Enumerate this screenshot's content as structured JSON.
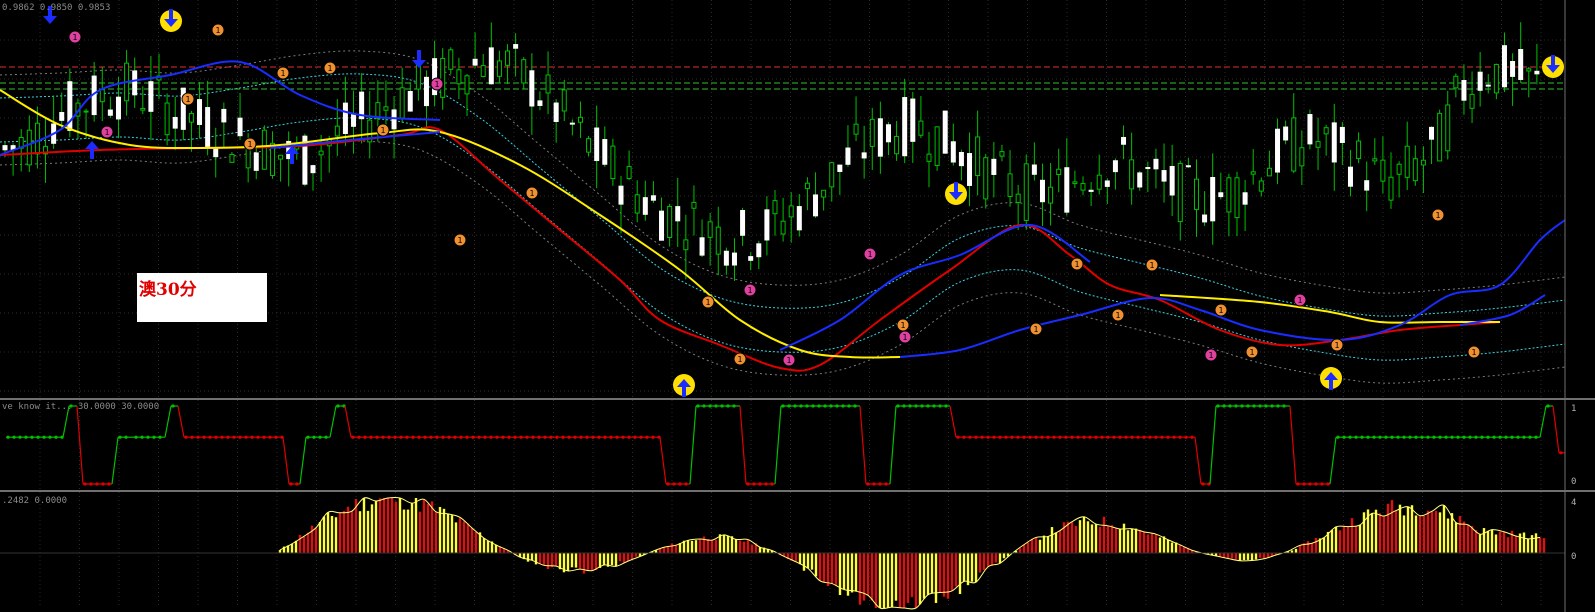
{
  "colors": {
    "background": "#000000",
    "bull": "#ffffff",
    "bear": "#00c000",
    "ema_fast": "#e00000",
    "ema_slow": "#ffee00",
    "ema_mid": "#1a2cff",
    "band": "#3ad1e0",
    "accent_level": "#e03030",
    "level_green": "#30c030",
    "osc_up": "#00c000",
    "osc_down": "#e00000",
    "hist_pos": "#ffff30",
    "hist_neg": "#e01010"
  },
  "main": {
    "header": "0.9862 0.9850 0.9853",
    "symbol_label": "澳30分",
    "arrow_icons": {
      "down": "down-arrow-icon",
      "up": "up-arrow-icon",
      "circle_down": "circle-down-signal-icon",
      "circle_up": "circle-up-signal-icon"
    }
  },
  "osc": {
    "header": "ve know it... 30.0000 30.0000",
    "scale_top": "1",
    "scale_bottom": "0"
  },
  "hist": {
    "header": ".2482 0.0000",
    "scale_top": "4",
    "scale_zero": "0"
  },
  "chart_data": [
    {
      "type": "candlestick",
      "title": "0.9862 0.9850 0.9853",
      "close": [
        0.984,
        0.9842,
        0.9846,
        0.9849,
        0.9851,
        0.9852,
        0.985,
        0.9847,
        0.9845,
        0.9843,
        0.9841,
        0.9839,
        0.9838,
        0.9842,
        0.9845,
        0.9848,
        0.9851,
        0.9853,
        0.9856,
        0.9858,
        0.9857,
        0.9853,
        0.9848,
        0.9842,
        0.9837,
        0.9832,
        0.9828,
        0.9826,
        0.9824,
        0.9822,
        0.9823,
        0.9826,
        0.983,
        0.9835,
        0.984,
        0.9843,
        0.9845,
        0.9843,
        0.984,
        0.9836,
        0.9833,
        0.9831,
        0.9832,
        0.9835,
        0.9838,
        0.9836,
        0.9833,
        0.9831,
        0.983,
        0.9832,
        0.9836,
        0.984,
        0.9842,
        0.984,
        0.9837,
        0.9833,
        0.9836,
        0.984,
        0.9852,
        0.9856,
        0.9855,
        0.9853
      ]
    }
  ]
}
